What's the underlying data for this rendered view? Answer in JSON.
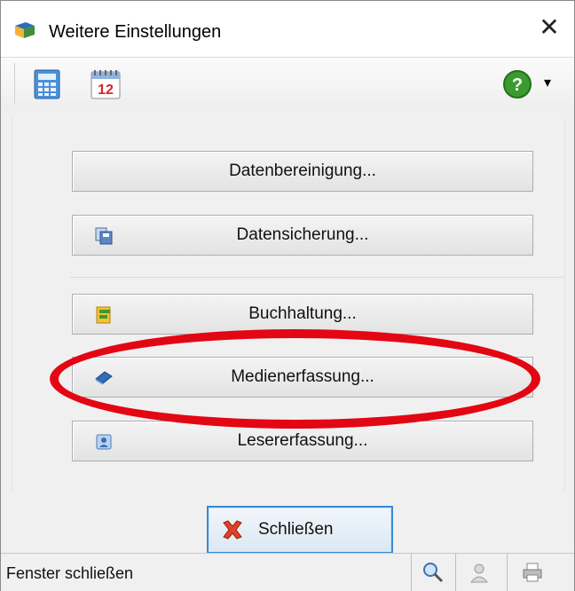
{
  "window": {
    "title": "Weitere Einstellungen",
    "close_glyph": "✕"
  },
  "toolbar": {
    "items": [
      {
        "icon": "calculator-icon"
      },
      {
        "icon": "calendar-icon",
        "calendar_day": "12"
      },
      {
        "icon": "help-icon",
        "glyph": "?"
      }
    ],
    "dropdown_glyph": "▾"
  },
  "buttons": [
    {
      "label": "Datenbereinigung...",
      "icon": null
    },
    {
      "label": "Datensicherung...",
      "icon": "backup-disk-icon"
    },
    {
      "label": "Buchhaltung...",
      "icon": "accounting-icon"
    },
    {
      "label": "Medienerfassung...",
      "icon": "media-book-icon"
    },
    {
      "label": "Lesererfassung...",
      "icon": "reader-card-icon"
    }
  ],
  "close_button": {
    "label": "Schließen",
    "icon": "red-x-icon"
  },
  "statusbar": {
    "text": "Fenster schließen",
    "icons": [
      "magnifier-icon",
      "user-icon",
      "printer-icon"
    ]
  },
  "annotation": {
    "color": "#e30613",
    "shape": "ellipse",
    "target": "Medienerfassung..."
  }
}
